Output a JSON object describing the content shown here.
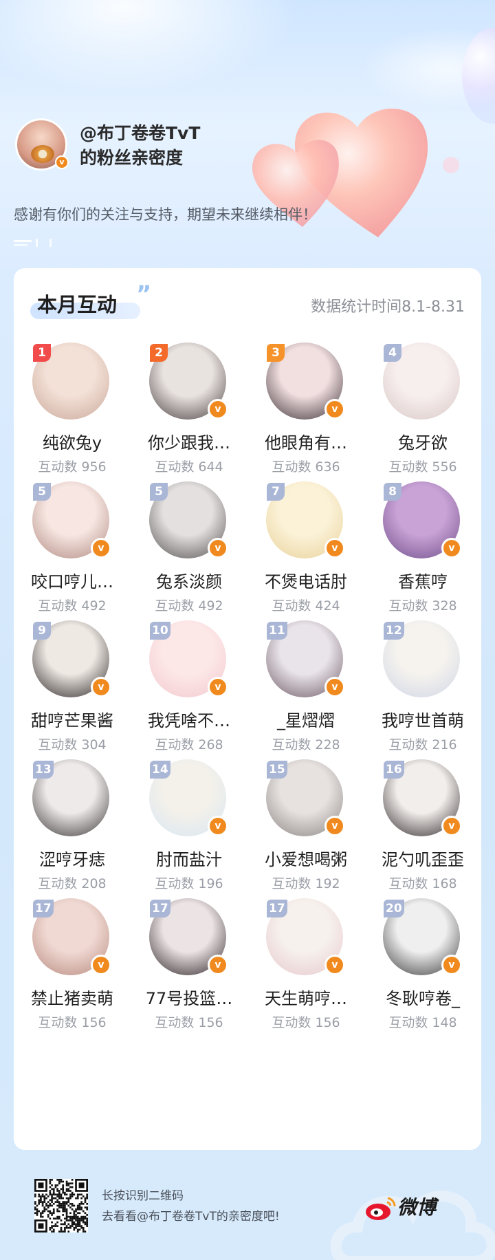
{
  "header": {
    "host_name_line1": "@布丁卷卷TvT",
    "host_name_line2": "的粉丝亲密度",
    "thanks": "感谢有你们的关注与支持，期望未来继续相伴！"
  },
  "card": {
    "title": "本月互动",
    "quote_mark": "”",
    "period": "数据统计时间8.1-8.31"
  },
  "fans": [
    {
      "rank": "1",
      "name": "纯欲兔y",
      "count": "互动数 956",
      "verified": false
    },
    {
      "rank": "2",
      "name": "你少跟我…",
      "count": "互动数 644",
      "verified": true
    },
    {
      "rank": "3",
      "name": "他眼角有…",
      "count": "互动数 636",
      "verified": true
    },
    {
      "rank": "4",
      "name": "兔牙欲",
      "count": "互动数 556",
      "verified": false
    },
    {
      "rank": "5",
      "name": "咬口哼儿…",
      "count": "互动数 492",
      "verified": true
    },
    {
      "rank": "5",
      "name": "兔系淡颜",
      "count": "互动数 492",
      "verified": true
    },
    {
      "rank": "7",
      "name": "不煲电话肘",
      "count": "互动数 424",
      "verified": true
    },
    {
      "rank": "8",
      "name": "香蕉哼",
      "count": "互动数 328",
      "verified": true
    },
    {
      "rank": "9",
      "name": "甜哼芒果酱",
      "count": "互动数 304",
      "verified": true
    },
    {
      "rank": "10",
      "name": "我凭啥不…",
      "count": "互动数 268",
      "verified": true
    },
    {
      "rank": "11",
      "name": "_星熠熠",
      "count": "互动数 228",
      "verified": true
    },
    {
      "rank": "12",
      "name": "我哼世首萌",
      "count": "互动数 216",
      "verified": false
    },
    {
      "rank": "13",
      "name": "涩哼牙痣",
      "count": "互动数 208",
      "verified": false
    },
    {
      "rank": "14",
      "name": "肘而盐汁",
      "count": "互动数 196",
      "verified": true
    },
    {
      "rank": "15",
      "name": "小爱想喝粥",
      "count": "互动数 192",
      "verified": true
    },
    {
      "rank": "16",
      "name": "泥勺叽歪歪",
      "count": "互动数 168",
      "verified": true
    },
    {
      "rank": "17",
      "name": "禁止猪卖萌",
      "count": "互动数 156",
      "verified": true
    },
    {
      "rank": "17",
      "name": "77号投篮…",
      "count": "互动数 156",
      "verified": true
    },
    {
      "rank": "17",
      "name": "天生萌哼…",
      "count": "互动数 156",
      "verified": true
    },
    {
      "rank": "20",
      "name": "冬耿哼卷_",
      "count": "互动数 148",
      "verified": true
    }
  ],
  "footer": {
    "line1": "长按识别二维码",
    "line2": "去看看@布丁卷卷TvT的亲密度吧!",
    "brand": "微博"
  },
  "colors": {
    "rank1": "#f24b4b",
    "rank2": "#f46a2a",
    "rank3": "#f6922a",
    "rank_other": "#aab6d6",
    "verified": "#f08a1e",
    "accent": "#9cc3f2"
  }
}
